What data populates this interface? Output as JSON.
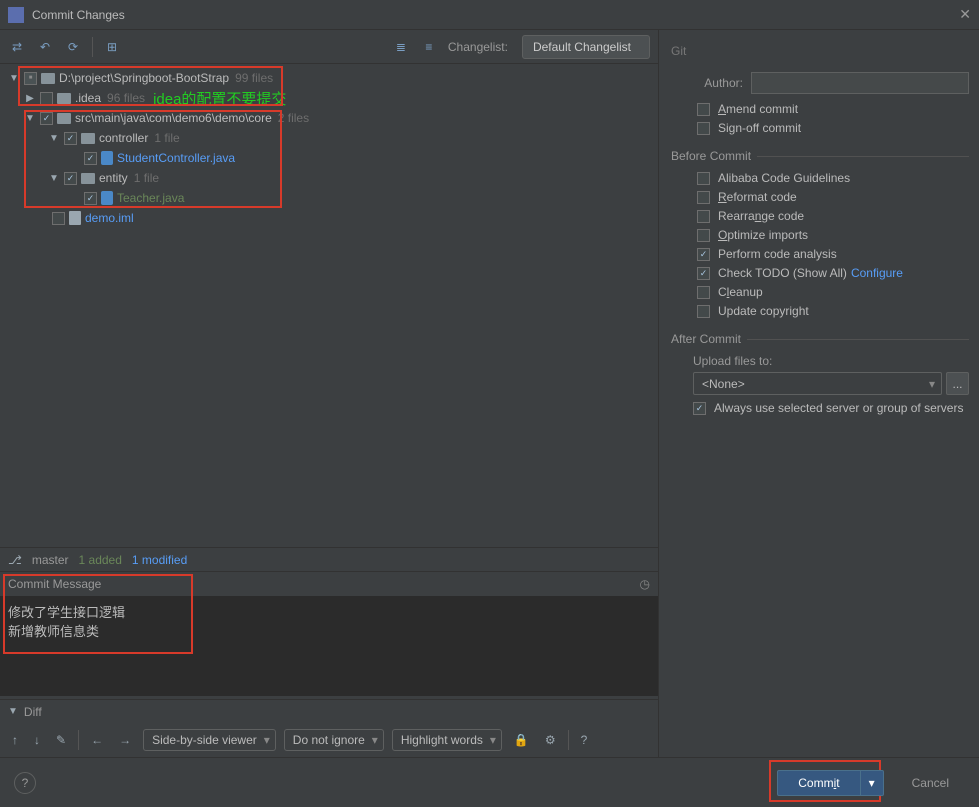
{
  "window": {
    "title": "Commit Changes"
  },
  "toolbar": {
    "changelist_label": "Changelist:",
    "changelist_value": "Default Changelist"
  },
  "tree": {
    "root": {
      "label": "D:\\project\\Springboot-BootStrap",
      "count": "99 files"
    },
    "idea": {
      "label": ".idea",
      "count": "96 files",
      "annotation": "idea的配置不要提交"
    },
    "src": {
      "label": "src\\main\\java\\com\\demo6\\demo\\core",
      "count": "2 files"
    },
    "controller": {
      "label": "controller",
      "count": "1 file"
    },
    "studentController": {
      "label": "StudentController.java"
    },
    "entity": {
      "label": "entity",
      "count": "1 file"
    },
    "teacher": {
      "label": "Teacher.java"
    },
    "demoIml": {
      "label": "demo.iml"
    }
  },
  "status": {
    "branch": "master",
    "added": "1 added",
    "modified": "1 modified"
  },
  "commitMsg": {
    "title": "Commit Message",
    "text": "修改了学生接口逻辑\n新增教师信息类"
  },
  "diff": {
    "title": "Diff",
    "viewer": "Side-by-side viewer",
    "ignore": "Do not ignore",
    "highlight": "Highlight words"
  },
  "right": {
    "git": "Git",
    "author_label": "Author:",
    "author_value": "",
    "amend": "Amend commit",
    "signoff": "Sign-off commit",
    "before_title": "Before Commit",
    "alibaba": "Alibaba Code Guidelines",
    "reformat": "Reformat code",
    "rearrange": "Rearrange code",
    "optimize": "Optimize imports",
    "perform": "Perform code analysis",
    "checktodo": "Check TODO (Show All)",
    "configure": "Configure",
    "cleanup": "Cleanup",
    "copyright": "Update copyright",
    "after_title": "After Commit",
    "upload_label": "Upload files to:",
    "upload_value": "<None>",
    "upload_more": "...",
    "always_use": "Always use selected server or group of servers"
  },
  "footer": {
    "commit": "Commit",
    "cancel": "Cancel",
    "help": "?"
  }
}
